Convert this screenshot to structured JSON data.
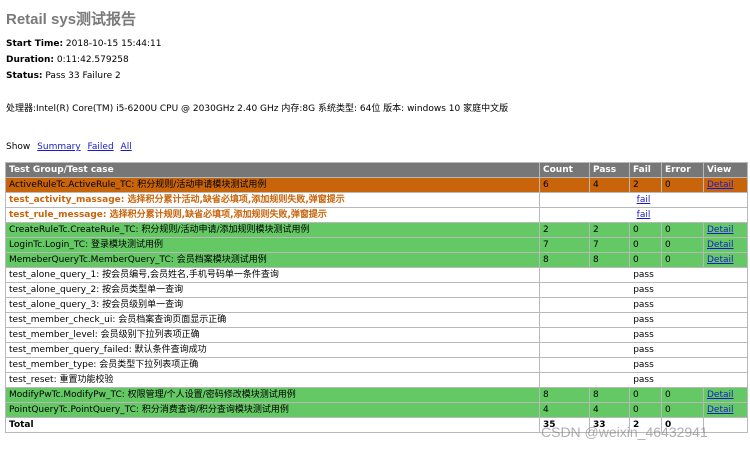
{
  "report": {
    "title": "Retail sys测试报告",
    "start_time_label": "Start Time:",
    "start_time": "2018-10-15 15:44:11",
    "duration_label": "Duration:",
    "duration": "0:11:42.579258",
    "status_label": "Status:",
    "status": "Pass 33 Failure 2",
    "system_info": "处理器:Intel(R) Core(TM) i5-6200U CPU @ 2030GHz 2.40 GHz 内存:8G 系统类型: 64位 版本: windows 10 家庭中文版"
  },
  "show": {
    "label": "Show",
    "links": [
      "Summary",
      "Failed",
      "All"
    ]
  },
  "table": {
    "headers": [
      "Test Group/Test case",
      "Count",
      "Pass",
      "Fail",
      "Error",
      "View"
    ],
    "rows": [
      {
        "kind": "fail-class",
        "name": "ActiveRuleTc.ActiveRule_TC: 积分规则/活动申请模块测试用例",
        "count": "6",
        "pass": "4",
        "fail": "2",
        "error": "0",
        "view": "Detail"
      },
      {
        "kind": "fail-case",
        "name": "test_activity_massage: 选择积分累计活动,缺省必填项,添加规则失败,弹窗提示",
        "result": "fail"
      },
      {
        "kind": "fail-case",
        "name": "test_rule_message: 选择积分累计规则,缺省必填项,添加规则失败,弹窗提示",
        "result": "fail"
      },
      {
        "kind": "pass-class",
        "name": "CreateRuleTc.CreateRule_TC: 积分规则/活动申请/添加规则模块测试用例",
        "count": "2",
        "pass": "2",
        "fail": "0",
        "error": "0",
        "view": "Detail"
      },
      {
        "kind": "pass-class",
        "name": "LoginTc.Login_TC: 登录模块测试用例",
        "count": "7",
        "pass": "7",
        "fail": "0",
        "error": "0",
        "view": "Detail"
      },
      {
        "kind": "pass-class",
        "name": "MemeberQueryTc.MemberQuery_TC: 会员档案模块测试用例",
        "count": "8",
        "pass": "8",
        "fail": "0",
        "error": "0",
        "view": "Detail"
      },
      {
        "kind": "pass-case",
        "name": "test_alone_query_1: 按会员编号,会员姓名,手机号码单一条件查询",
        "result": "pass"
      },
      {
        "kind": "pass-case",
        "name": "test_alone_query_2: 按会员类型单一查询",
        "result": "pass"
      },
      {
        "kind": "pass-case",
        "name": "test_alone_query_3: 按会员级别单一查询",
        "result": "pass"
      },
      {
        "kind": "pass-case",
        "name": "test_member_check_ui: 会员档案查询页面显示正确",
        "result": "pass"
      },
      {
        "kind": "pass-case",
        "name": "test_member_level: 会员级别下拉列表项正确",
        "result": "pass"
      },
      {
        "kind": "pass-case",
        "name": "test_member_query_failed: 默认条件查询成功",
        "result": "pass"
      },
      {
        "kind": "pass-case",
        "name": "test_member_type: 会员类型下拉列表项正确",
        "result": "pass"
      },
      {
        "kind": "pass-case",
        "name": "test_reset: 重置功能校验",
        "result": "pass"
      },
      {
        "kind": "pass-class",
        "name": "ModifyPwTc.ModifyPw_TC: 权限管理/个人设置/密码修改模块测试用例",
        "count": "8",
        "pass": "8",
        "fail": "0",
        "error": "0",
        "view": "Detail"
      },
      {
        "kind": "pass-class",
        "name": "PointQueryTc.PointQuery_TC: 积分消费查询/积分查询模块测试用例",
        "count": "4",
        "pass": "4",
        "fail": "0",
        "error": "0",
        "view": "Detail"
      }
    ],
    "total": {
      "label": "Total",
      "count": "35",
      "pass": "33",
      "fail": "2",
      "error": "0"
    }
  },
  "watermark": "CSDN @weixin_46432941",
  "colors": {
    "fail_class": "#c8640a",
    "pass_class": "#64c864",
    "header": "#777777",
    "title": "#7a7a7a",
    "link": "#1a1acc"
  }
}
